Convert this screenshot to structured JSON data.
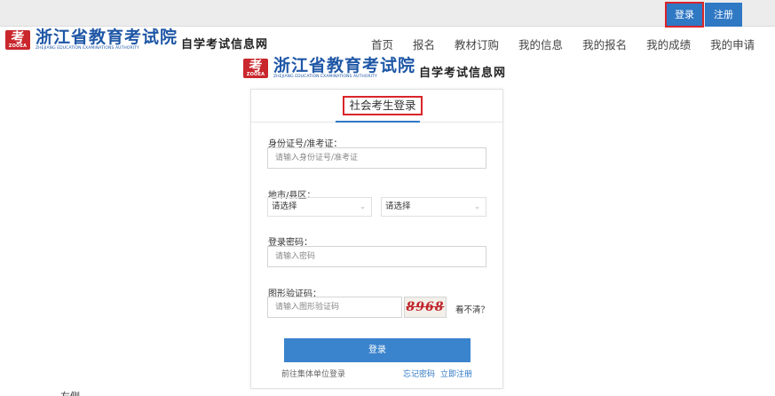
{
  "topbar": {
    "login_label": "登录",
    "register_label": "注册"
  },
  "brand": {
    "badge_char": "考",
    "badge_sub": "ZOOEA",
    "name_cn": "浙江省教育考试院",
    "name_en": "ZHEJIANG EDUCATION EXAMINATIONS AUTHORITY",
    "site_name": "自学考试信息网"
  },
  "nav": {
    "items": [
      {
        "label": "首页"
      },
      {
        "label": "报名"
      },
      {
        "label": "教材订购"
      },
      {
        "label": "我的信息"
      },
      {
        "label": "我的报名"
      },
      {
        "label": "我的成绩"
      },
      {
        "label": "我的申请"
      }
    ]
  },
  "login_form": {
    "tab_label": "社会考生登录",
    "id_label": "身份证号/准考证：",
    "id_placeholder": "请输入身份证号/准考证",
    "region_label": "地市/县区：",
    "city_select": "请选择",
    "county_select": "请选择",
    "password_label": "登录密码：",
    "password_placeholder": "请输入密码",
    "captcha_label": "图形验证码：",
    "captcha_placeholder": "请输入图形验证码",
    "captcha_text": "8968",
    "captcha_refresh": "看不清？",
    "submit_label": "登录",
    "group_link": "前往集体单位登录",
    "forgot_link": "忘记密码",
    "register_link": "立即注册"
  },
  "stray_text": "左侧"
}
